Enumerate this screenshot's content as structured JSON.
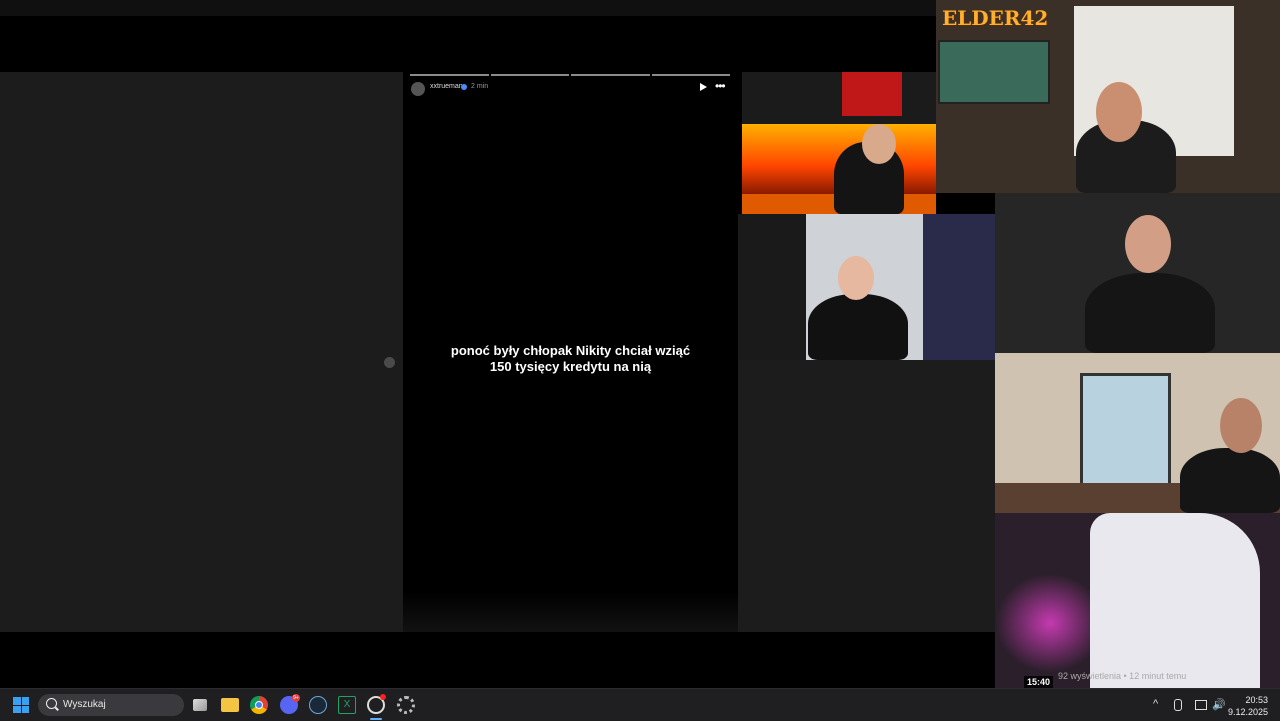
{
  "story": {
    "username": "xxtrueman",
    "time_ago": "2 min",
    "caption_line1": "ponoć były chłopak Nikity chciał wziąć",
    "caption_line2": "150 tysięcy kredytu na nią",
    "progress_segments": 4
  },
  "overlay": {
    "logo_text": "ELDER42",
    "video_duration": "15:40",
    "video_meta": "92 wyświetlenia • 12 minut temu"
  },
  "taskbar": {
    "search_placeholder": "Wyszukaj",
    "discord_badge": "9+",
    "excel_glyph": "X",
    "volume_glyph": "🔊",
    "chevron_glyph": "^",
    "time": "20:53",
    "date": "9.12.2025",
    "icons": [
      "windows-start-icon",
      "search-icon",
      "task-view-icon",
      "file-explorer-icon",
      "chrome-icon",
      "discord-icon",
      "steam-icon",
      "excel-icon",
      "obs-icon",
      "settings-icon"
    ]
  },
  "colors": {
    "taskbar_bg": "#1f1f22",
    "accent_blue": "#3aa0f0",
    "story_bg": "#000000",
    "panel_bg": "#1c1c1c"
  }
}
